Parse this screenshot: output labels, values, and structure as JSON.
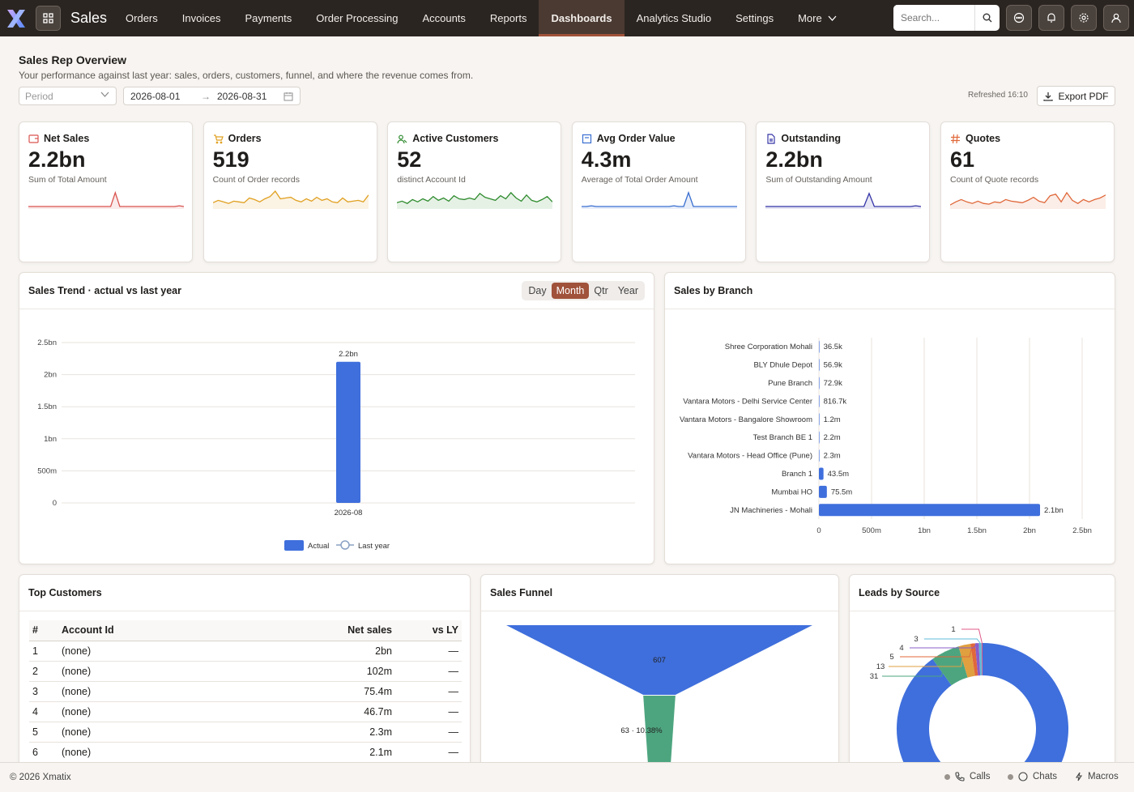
{
  "app": {
    "title": "Sales"
  },
  "nav": {
    "items": [
      "Orders",
      "Invoices",
      "Payments",
      "Order Processing",
      "Accounts",
      "Reports",
      "Dashboards",
      "Analytics Studio",
      "Settings",
      "More"
    ],
    "active": "Dashboards"
  },
  "search": {
    "placeholder": "Search..."
  },
  "header": {
    "title": "Sales Rep Overview",
    "subtitle": "Your performance against last year: sales, orders, customers, funnel, and where the revenue comes from.",
    "period_placeholder": "Period",
    "date_from": "2026-08-01",
    "date_to": "2026-08-31",
    "date_arrow": "→",
    "refreshed": "Refreshed 16:10",
    "export_label": "Export PDF"
  },
  "kpis": [
    {
      "title": "Net Sales",
      "value": "2.2bn",
      "desc": "Sum of Total Amount",
      "color": "#d9534f",
      "icon": "wallet-icon"
    },
    {
      "title": "Orders",
      "value": "519",
      "desc": "Count of Order records",
      "color": "#e0a020",
      "icon": "cart-icon"
    },
    {
      "title": "Active Customers",
      "value": "52",
      "desc": "distinct Account Id",
      "color": "#2e8b2e",
      "icon": "users-icon"
    },
    {
      "title": "Avg Order Value",
      "value": "4.3m",
      "desc": "Average of Total Order Amount",
      "color": "#3a6fd0",
      "icon": "receipt-icon"
    },
    {
      "title": "Outstanding",
      "value": "2.2bn",
      "desc": "Sum of Outstanding Amount",
      "color": "#3535a8",
      "icon": "document-icon"
    },
    {
      "title": "Quotes",
      "value": "61",
      "desc": "Count of Quote records",
      "color": "#e0683a",
      "icon": "hash-icon"
    }
  ],
  "sales_trend": {
    "title": "Sales Trend · actual vs last year",
    "granularity": [
      "Day",
      "Month",
      "Qtr",
      "Year"
    ],
    "selected": "Month",
    "legend": {
      "actual": "Actual",
      "last_year": "Last year"
    }
  },
  "sales_by_branch": {
    "title": "Sales by Branch"
  },
  "top_customers": {
    "title": "Top Customers",
    "columns": [
      "#",
      "Account Id",
      "Net sales",
      "vs LY"
    ],
    "rows": [
      [
        "1",
        "(none)",
        "2bn",
        "—"
      ],
      [
        "2",
        "(none)",
        "102m",
        "—"
      ],
      [
        "3",
        "(none)",
        "75.4m",
        "—"
      ],
      [
        "4",
        "(none)",
        "46.7m",
        "—"
      ],
      [
        "5",
        "(none)",
        "2.3m",
        "—"
      ],
      [
        "6",
        "(none)",
        "2.1m",
        "—"
      ]
    ]
  },
  "sales_funnel": {
    "title": "Sales Funnel"
  },
  "leads_by_source": {
    "title": "Leads by Source"
  },
  "footer": {
    "copyright": "© 2026 Xmatix",
    "calls": "Calls",
    "chats": "Chats",
    "macros": "Macros"
  },
  "chart_data": [
    {
      "type": "bar",
      "title": "Sales Trend · actual vs last year",
      "categories": [
        "2026-08"
      ],
      "series": [
        {
          "name": "Actual",
          "values": [
            2.2
          ]
        },
        {
          "name": "Last year",
          "values": [
            null
          ]
        }
      ],
      "unit": "bn",
      "ylim": [
        0,
        2.5
      ],
      "yticks": [
        "0",
        "500m",
        "1bn",
        "1.5bn",
        "2bn",
        "2.5bn"
      ],
      "data_labels": [
        "2.2bn"
      ],
      "legend": "bottom",
      "grid": true
    },
    {
      "type": "bar",
      "orientation": "horizontal",
      "title": "Sales by Branch",
      "categories": [
        "Shree Corporation Mohali",
        "BLY Dhule Depot",
        "Pune Branch",
        "Vantara Motors - Delhi Service Center",
        "Vantara Motors - Bangalore Showroom",
        "Test Branch BE 1",
        "Vantara Motors - Head Office (Pune)",
        "Branch 1",
        "Mumbai HO",
        "JN Machineries - Mohali"
      ],
      "values": [
        36500,
        56900,
        72900,
        816700,
        1200000,
        2200000,
        2300000,
        43500000,
        75500000,
        2100000000
      ],
      "data_labels": [
        "36.5k",
        "56.9k",
        "72.9k",
        "816.7k",
        "1.2m",
        "2.2m",
        "2.3m",
        "43.5m",
        "75.5m",
        "2.1bn"
      ],
      "xlim": [
        0,
        2500000000
      ],
      "xticks": [
        "0",
        "500m",
        "1bn",
        "1.5bn",
        "2bn",
        "2.5bn"
      ],
      "grid": true
    },
    {
      "type": "funnel",
      "title": "Sales Funnel",
      "stages": [
        {
          "value": 607,
          "label": "607",
          "color": "#3f6fdc"
        },
        {
          "value": 63,
          "label": "63 · 10.38%",
          "color": "#4da57f"
        }
      ]
    },
    {
      "type": "pie",
      "style": "donut",
      "title": "Leads by Source",
      "values": [
        520,
        31,
        13,
        5,
        4,
        3,
        1
      ],
      "labels": [
        "",
        "31",
        "13",
        "5",
        "4",
        "3",
        "1"
      ],
      "colors": [
        "#3f6fdc",
        "#4da57f",
        "#e0a040",
        "#e0683a",
        "#8a5cc8",
        "#5fbbd8",
        "#e05a8a"
      ]
    }
  ]
}
